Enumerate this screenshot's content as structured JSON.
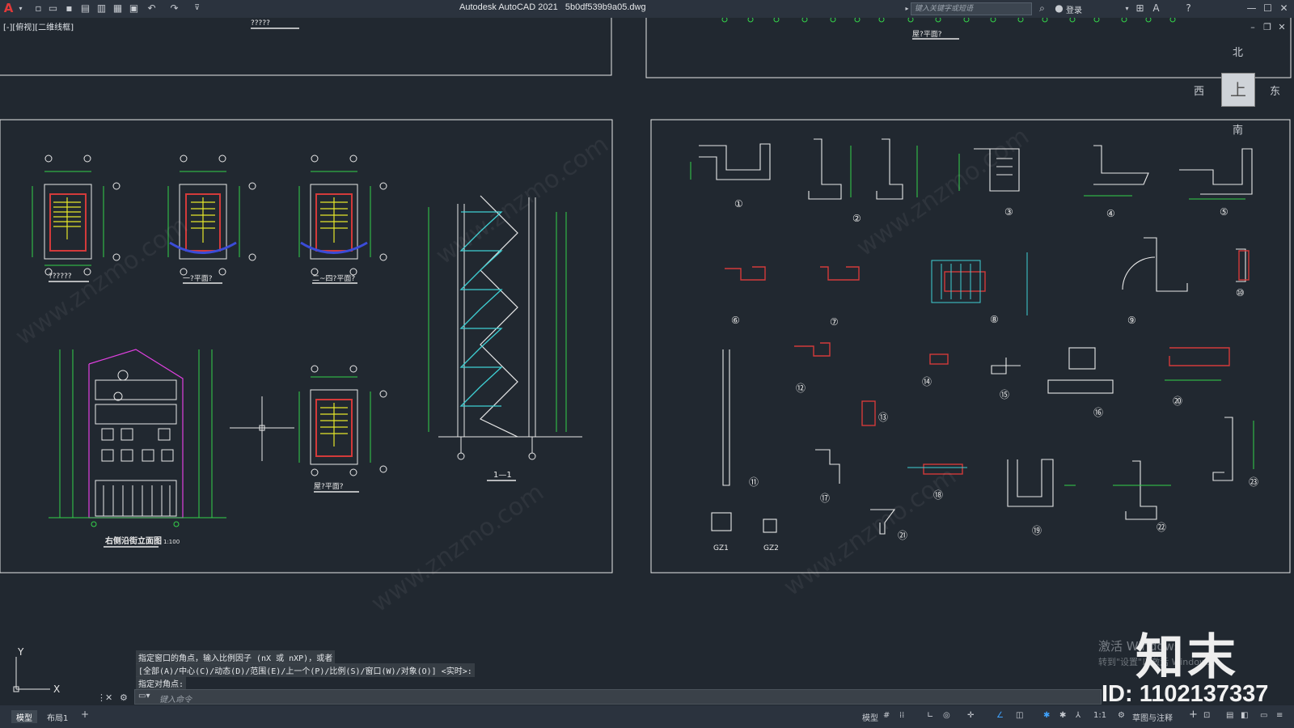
{
  "app": {
    "title": "Autodesk AutoCAD 2021",
    "filename": "5b0df539b9a05.dwg",
    "logo": "A"
  },
  "toolbar": {
    "icons": [
      "new-icon",
      "open-icon",
      "save-icon",
      "saveas-icon",
      "plot-icon",
      "publish-icon",
      "print-icon",
      "undo-icon",
      "redo-icon",
      "customize-icon"
    ]
  },
  "search": {
    "placeholder": "键入关键字或短语"
  },
  "user": {
    "login": "登录"
  },
  "viewport": {
    "label": "[-][俯视][二维线框]"
  },
  "viewcube": {
    "north": "北",
    "south": "南",
    "east": "东",
    "west": "西",
    "top": "上"
  },
  "drawings": {
    "left_top_title": "?????",
    "right_top_title": "屋?平面?",
    "stair_plans": [
      "??????",
      "一?平面?",
      "二~四?平面?",
      "屋?平面?"
    ],
    "section_title": "1—1",
    "elevation_title": "右侧沿街立面图",
    "elevation_scale": "1:100",
    "details": [
      "①",
      "②",
      "③",
      "④",
      "⑤",
      "⑥",
      "⑦",
      "⑧",
      "⑨",
      "⑩",
      "⑪",
      "⑫",
      "⑬",
      "⑭",
      "⑮",
      "⑯",
      "⑰",
      "⑱",
      "⑲",
      "⑳",
      "㉑",
      "㉒",
      "㉓"
    ],
    "columns": [
      "GZ1",
      "GZ2"
    ]
  },
  "command": {
    "history": [
      "指定窗口的角点，输入比例因子 (nX 或 nXP)，或者",
      "[全部(A)/中心(C)/动态(D)/范围(E)/上一个(P)/比例(S)/窗口(W)/对象(O)] <实时>:",
      "指定对角点:"
    ],
    "placeholder": "键入命令"
  },
  "tabs": [
    "模型",
    "布局1"
  ],
  "status": {
    "model": "模型",
    "scale": "1:1",
    "workspace": "草图与注释"
  },
  "windows": {
    "activate": "激活 Windows",
    "hint": "转到\"设置\"以激活 Windows。"
  },
  "watermark": {
    "site": "www.znzmo.com",
    "brand": "知末",
    "id": "ID: 1102137337"
  },
  "colors": {
    "bg": "#212830",
    "cyan": "#3fd0d4",
    "green": "#34d24a",
    "yellow": "#e6e62a",
    "red": "#d33a3a",
    "white": "#e8e8e8",
    "magenta": "#e040e0"
  }
}
